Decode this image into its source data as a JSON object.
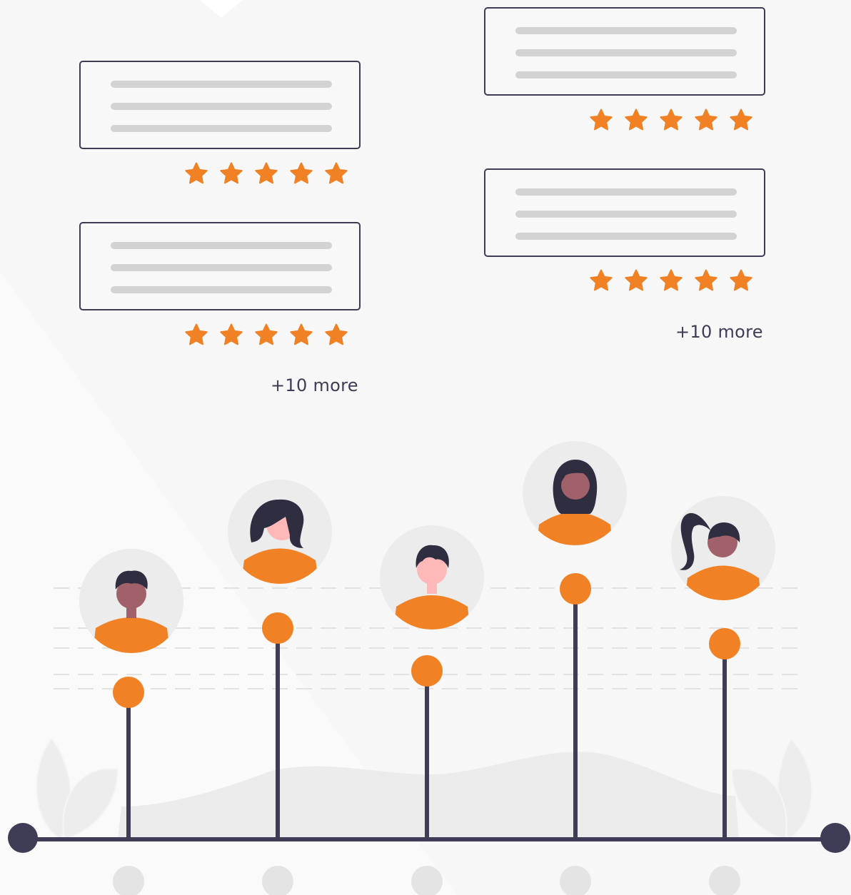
{
  "left_column": {
    "reviews": [
      {
        "rating": 5
      },
      {
        "rating": 5
      }
    ],
    "more_label": "+10 more"
  },
  "right_column": {
    "reviews": [
      {
        "rating": 5
      },
      {
        "rating": 5
      }
    ],
    "more_label": "+10 more"
  },
  "icons": {
    "star": "star-icon",
    "avatar": "user-avatar-icon"
  },
  "colors": {
    "accent": "#f08124",
    "dark": "#3f3d56",
    "placeholder": "#d3d3d3",
    "background": "#f7f7f7"
  }
}
